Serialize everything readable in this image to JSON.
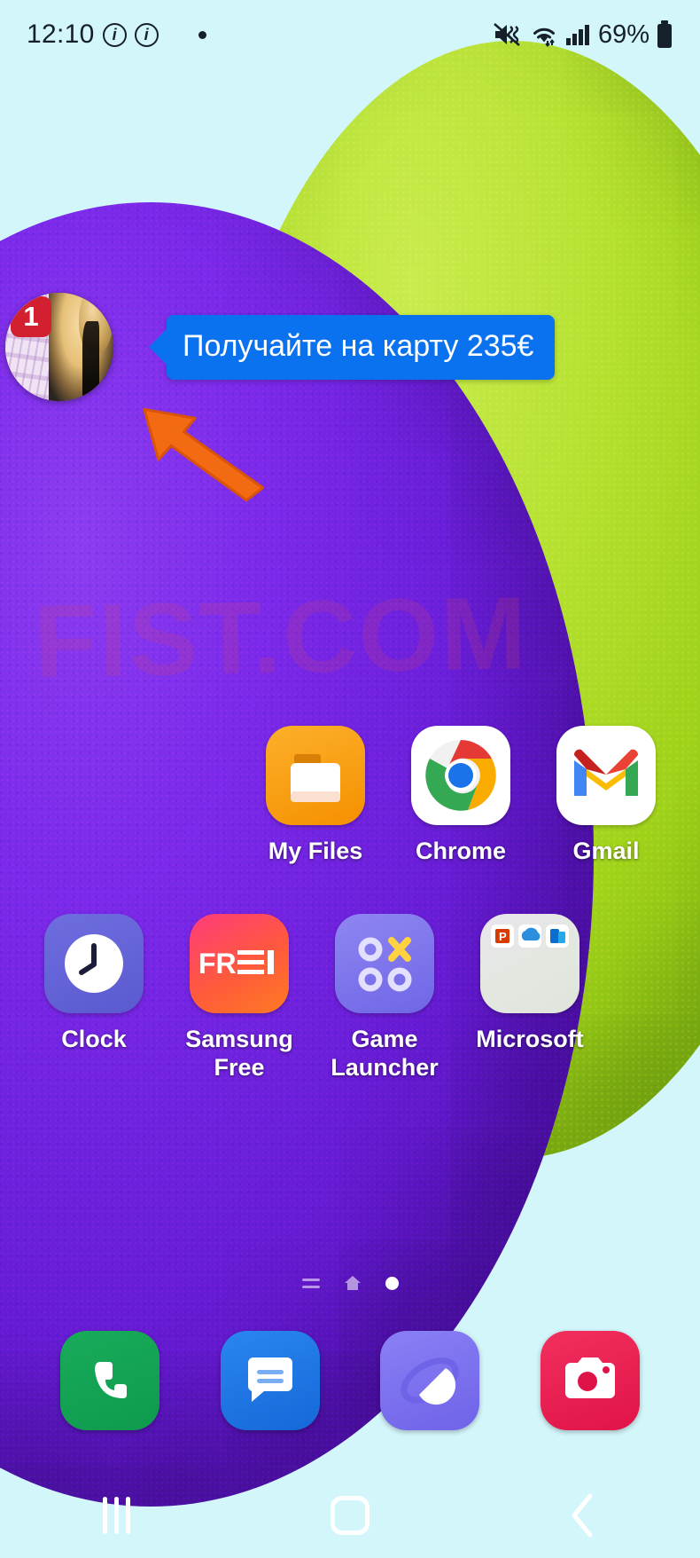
{
  "status_bar": {
    "clock": "12:10",
    "info_icon_1": "info-circle-icon",
    "info_icon_2": "info-circle-icon",
    "notification_dot": "notification-dot",
    "mute_icon": "volume-mute-vibrate-icon",
    "wifi_icon": "wifi-icon",
    "signal_icon": "cellular-signal-icon",
    "battery_percent": "69%",
    "battery_icon": "battery-icon"
  },
  "notification_bubble": {
    "badge_count": "1",
    "message": "Получайте на карту 235€",
    "avatar_name": "contact-avatar",
    "accent_color": "#0a72ee",
    "badge_color": "#d32030"
  },
  "pointer": {
    "arrow_name": "orange-pointer-arrow",
    "color": "#f26a12"
  },
  "wallpaper": {
    "watermark": "FIST.COM",
    "background_color": "#d3f6fb",
    "green_color": "#b6e132",
    "purple_color": "#7a2ae8"
  },
  "app_grid": {
    "row1": [
      {
        "label": "My Files",
        "icon": "my-files-icon"
      },
      {
        "label": "Chrome",
        "icon": "chrome-icon"
      },
      {
        "label": "Gmail",
        "icon": "gmail-icon"
      }
    ],
    "row2": [
      {
        "label": "Clock",
        "icon": "clock-icon"
      },
      {
        "label": "Samsung Free",
        "icon": "samsung-free-icon"
      },
      {
        "label": "Game Launcher",
        "icon": "game-launcher-icon"
      },
      {
        "label": "Microsoft",
        "icon": "microsoft-folder-icon"
      }
    ]
  },
  "page_indicator": {
    "pages": 3,
    "active_index": 2,
    "items": [
      "app-list-page-icon",
      "home-page-icon",
      "current-page-dot"
    ]
  },
  "dock": [
    {
      "label": "Phone",
      "icon": "phone-icon"
    },
    {
      "label": "Messages",
      "icon": "messages-icon"
    },
    {
      "label": "Internet",
      "icon": "samsung-internet-icon"
    },
    {
      "label": "Camera",
      "icon": "camera-icon"
    }
  ],
  "nav_bar": [
    {
      "label": "Recents",
      "icon": "recent-apps-icon"
    },
    {
      "label": "Home",
      "icon": "home-icon"
    },
    {
      "label": "Back",
      "icon": "back-icon"
    }
  ]
}
